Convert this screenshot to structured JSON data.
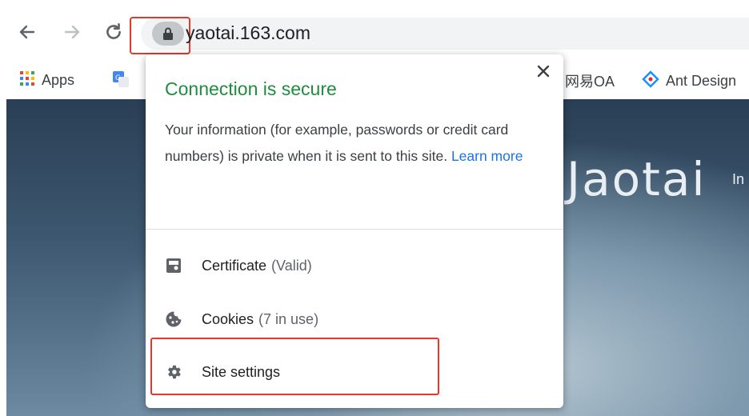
{
  "toolbar": {
    "url": "yaotai.163.com",
    "icons": [
      "back-arrow-icon",
      "forward-arrow-icon",
      "reload-icon",
      "lock-icon"
    ]
  },
  "bookmarks": [
    {
      "label": "Apps",
      "icon": "apps-grid-icon"
    },
    {
      "label": "",
      "icon": "translate-icon"
    },
    {
      "label": "网易OA",
      "icon": ""
    },
    {
      "label": "Ant Design",
      "icon": "ant-design-icon"
    }
  ],
  "page": {
    "brand": "Jaotai",
    "brand_suffix": "In"
  },
  "popup": {
    "title": "Connection is secure",
    "body": "Your information (for example, passwords or credit card numbers) is private when it is sent to this site.",
    "learn_more": "Learn more",
    "rows": [
      {
        "label": "Certificate",
        "detail": "(Valid)",
        "icon": "certificate-icon"
      },
      {
        "label": "Cookies",
        "detail": "(7 in use)",
        "icon": "cookie-icon"
      },
      {
        "label": "Site settings",
        "detail": "",
        "icon": "gear-icon"
      }
    ]
  },
  "colors": {
    "title_green": "#1e8e3e",
    "link_blue": "#1a73e8",
    "highlight_red": "#e03a2f"
  }
}
